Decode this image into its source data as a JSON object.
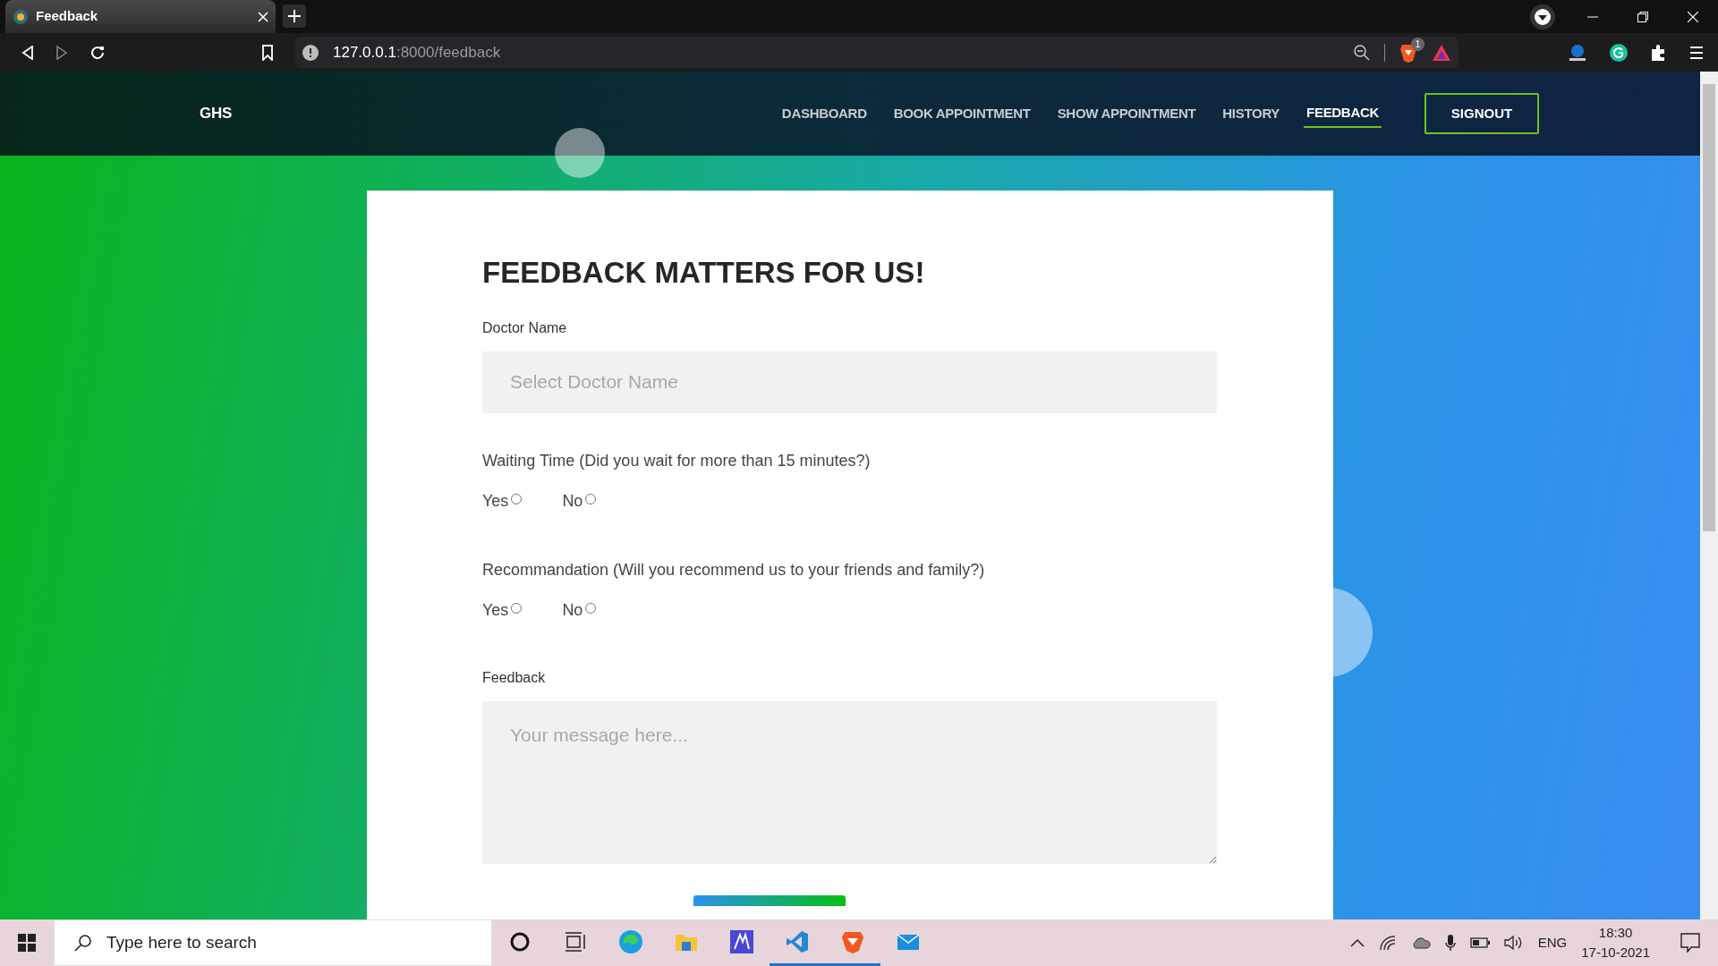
{
  "browser": {
    "tab_title": "Feedback",
    "url_host": "127.0.0.1",
    "url_rest": ":8000/feedback",
    "shield_count": "1"
  },
  "navbar": {
    "brand": "GHS",
    "links": [
      {
        "label": "DASHBOARD",
        "selected": false
      },
      {
        "label": "BOOK APPOINTMENT",
        "selected": false
      },
      {
        "label": "SHOW APPOINTMENT",
        "selected": false
      },
      {
        "label": "HISTORY",
        "selected": false
      },
      {
        "label": "FEEDBACK",
        "selected": true
      }
    ],
    "signout": "SIGNOUT"
  },
  "form": {
    "heading": "FEEDBACK MATTERS FOR US!",
    "doctor_label": "Doctor Name",
    "doctor_placeholder": "Select Doctor Name",
    "questions": [
      {
        "text": "Waiting Time (Did you wait for more than 15 minutes?)",
        "options": [
          {
            "label": "Yes",
            "selected": false
          },
          {
            "label": "No",
            "selected": false
          }
        ]
      },
      {
        "text": "Recommandation (Will you recommend us to your friends and family?)",
        "options": [
          {
            "label": "Yes",
            "selected": false
          },
          {
            "label": "No",
            "selected": false
          }
        ]
      }
    ],
    "feedback_label": "Feedback",
    "feedback_placeholder": "Your message here..."
  },
  "taskbar": {
    "search_placeholder": "Type here to search",
    "apps": [
      {
        "kind": "cortana",
        "open": false
      },
      {
        "kind": "taskview",
        "open": false
      },
      {
        "kind": "edge",
        "open": false
      },
      {
        "kind": "explorer",
        "open": false
      },
      {
        "kind": "editor",
        "open": false
      },
      {
        "kind": "vscode",
        "open": true
      },
      {
        "kind": "brave",
        "open": true
      },
      {
        "kind": "mail",
        "open": false
      }
    ],
    "language": "ENG",
    "time": "18:30",
    "date": "17-10-2021"
  }
}
